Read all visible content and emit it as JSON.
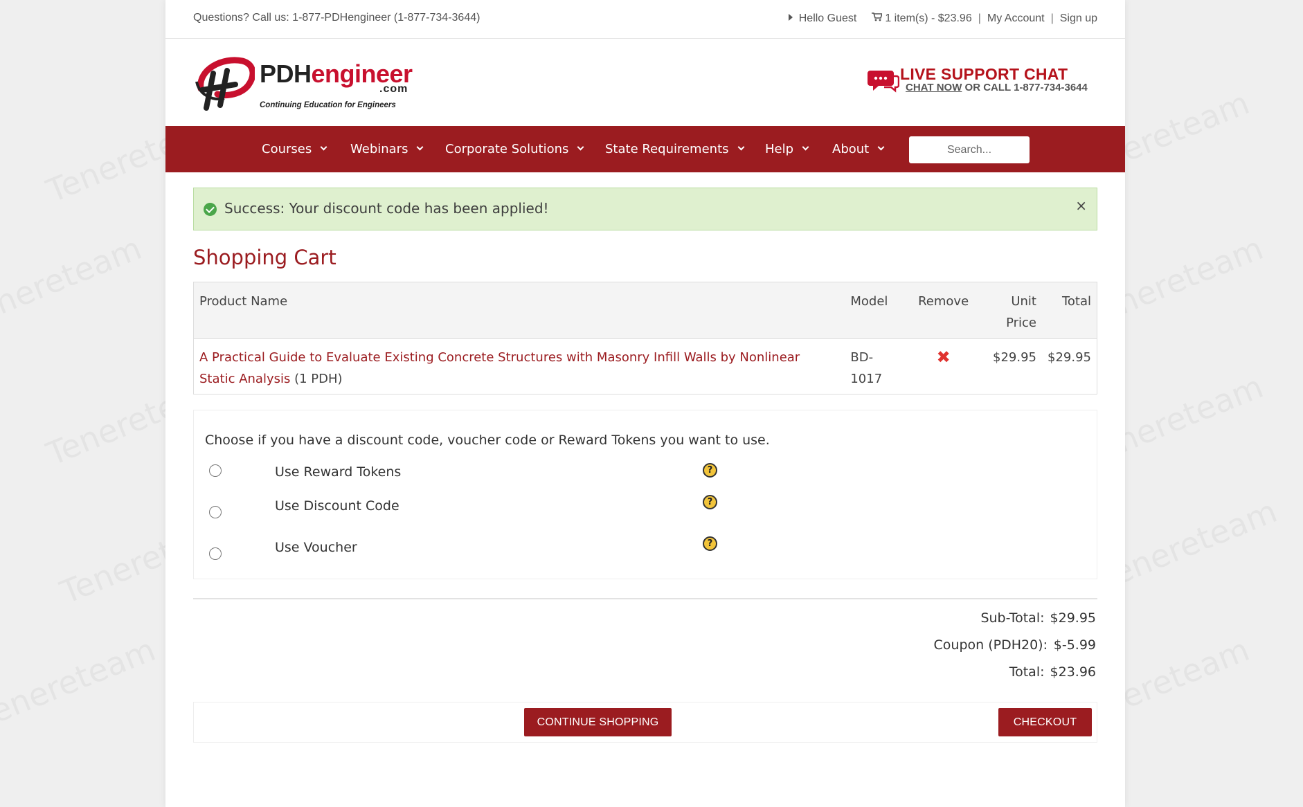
{
  "topbar": {
    "phone": "Questions? Call us: 1-877-PDHengineer (1-877-734-3644)",
    "greeting": "Hello Guest",
    "cart_summary": "1 item(s) - $23.96",
    "separator": "|",
    "my_account": "My Account",
    "sign_up": "Sign up"
  },
  "brand": {
    "name_pdh": "PDH",
    "name_engineer": "engineer",
    "domain": ".com",
    "tagline": "Continuing Education for Engineers",
    "accent_color": "#9b1c20"
  },
  "live_chat": {
    "title": "LIVE SUPPORT CHAT",
    "chat_now": "CHAT NOW",
    "call_text": " OR CALL 1-877-734-3644"
  },
  "nav": {
    "items": [
      {
        "label": "Courses"
      },
      {
        "label": "Webinars"
      },
      {
        "label": "Corporate Solutions"
      },
      {
        "label": "State Requirements"
      },
      {
        "label": "Help"
      },
      {
        "label": "About"
      }
    ],
    "search_placeholder": "Search..."
  },
  "alert": {
    "message": "Success: Your discount code has been applied!",
    "close": "×"
  },
  "page_title": "Shopping Cart",
  "cart": {
    "headers": {
      "product": "Product Name",
      "model": "Model",
      "remove": "Remove",
      "unit_price_1": "Unit",
      "unit_price_2": "Price",
      "total": "Total"
    },
    "rows": [
      {
        "product": "A Practical Guide to Evaluate Existing Concrete Structures with Masonry Infill Walls by Nonlinear Static Analysis",
        "pdh": " (1 PDH)",
        "model_1": "BD-",
        "model_2": "1017",
        "remove_icon": "✖",
        "unit_price": "$29.95",
        "total": "$29.95"
      }
    ]
  },
  "discount": {
    "intro": "Choose if you have a discount code, voucher code or Reward Tokens you want to use.",
    "options": [
      {
        "label": "Use Reward Tokens",
        "help": "?"
      },
      {
        "label": "Use Discount Code",
        "help": "?"
      },
      {
        "label": "Use Voucher",
        "help": "?"
      }
    ]
  },
  "totals": {
    "subtotal_label": "Sub-Total:",
    "subtotal_value": "$29.95",
    "coupon_label": "Coupon (PDH20):",
    "coupon_value": "$-5.99",
    "total_label": "Total:",
    "total_value": "$23.96"
  },
  "buttons": {
    "continue": "CONTINUE SHOPPING",
    "checkout": "CHECKOUT"
  },
  "watermark": "Tenereteam"
}
